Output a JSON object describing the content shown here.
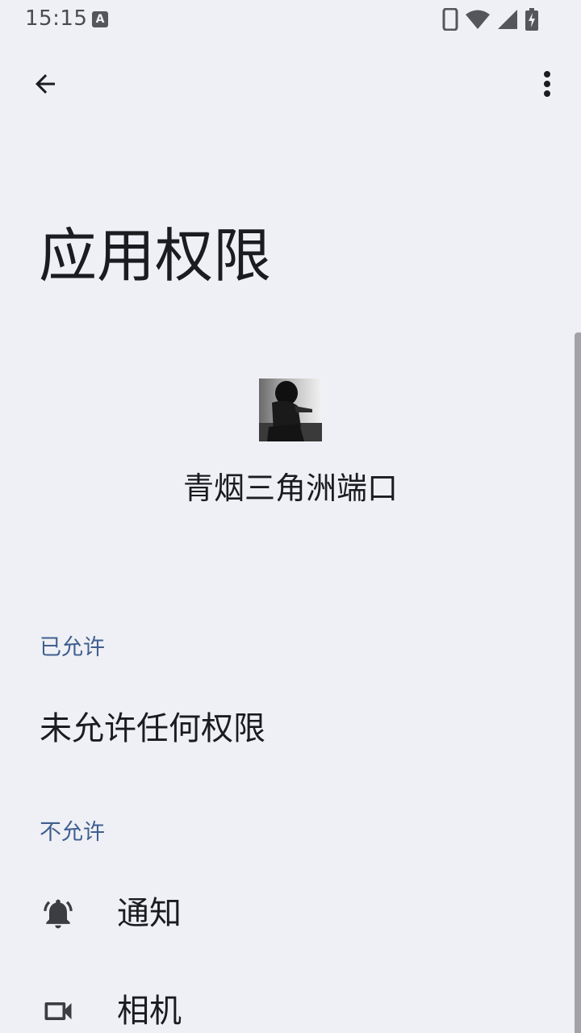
{
  "status_bar": {
    "time": "15:15",
    "notification_icon": "a-letter-icon",
    "icons": [
      "phone-icon",
      "wifi-icon",
      "signal-icon",
      "battery-charging-icon"
    ]
  },
  "toolbar": {
    "back_icon": "back-arrow-icon",
    "more_icon": "more-vert-icon"
  },
  "page": {
    "title": "应用权限"
  },
  "app": {
    "name": "青烟三角洲端口",
    "icon": "app-photo-icon"
  },
  "allowed": {
    "header": "已允许",
    "empty_text": "未允许任何权限"
  },
  "denied": {
    "header": "不允许",
    "items": [
      {
        "label": "通知",
        "icon": "bell-icon"
      },
      {
        "label": "相机",
        "icon": "camera-icon"
      }
    ]
  },
  "colors": {
    "background": "#eff0f5",
    "accent": "#3f5f90",
    "text": "#1b1c20"
  }
}
